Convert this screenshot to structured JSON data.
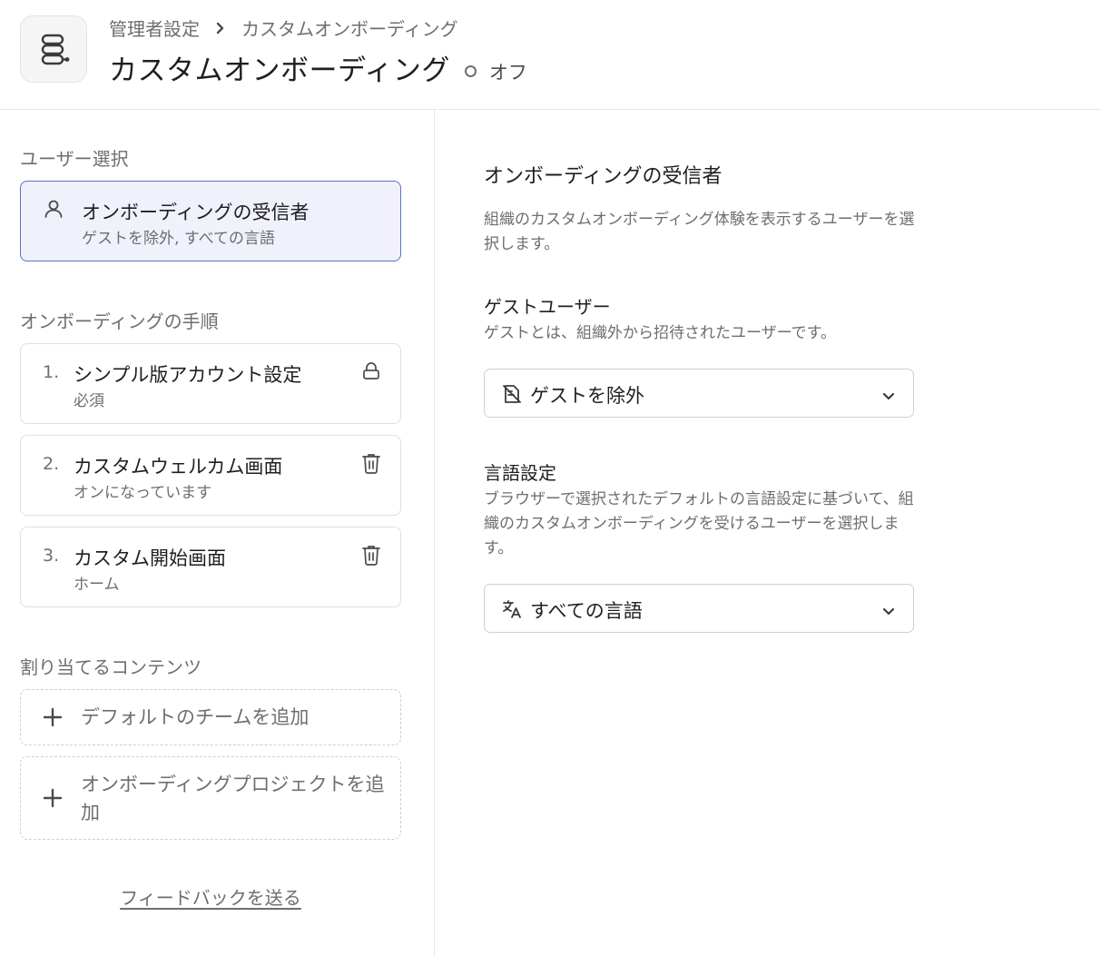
{
  "header": {
    "app_icon": "onboarding-icon",
    "breadcrumb": {
      "parent": "管理者設定",
      "current": "カスタムオンボーディング"
    },
    "title": "カスタムオンボーディング",
    "status": "オフ"
  },
  "left": {
    "user_select_label": "ユーザー選択",
    "recipient": {
      "icon": "user-icon",
      "title": "オンボーディングの受信者",
      "subtitle": "ゲストを除外, すべての言語"
    },
    "steps_label": "オンボーディングの手順",
    "steps": [
      {
        "num": "1.",
        "title": "シンプル版アカウント設定",
        "subtitle": "必須",
        "action_icon": "lock-icon"
      },
      {
        "num": "2.",
        "title": "カスタムウェルカム画面",
        "subtitle": "オンになっています",
        "action_icon": "trash-icon"
      },
      {
        "num": "3.",
        "title": "カスタム開始画面",
        "subtitle": "ホーム",
        "action_icon": "trash-icon"
      }
    ],
    "content_label": "割り当てるコンテンツ",
    "add_items": [
      {
        "label": "デフォルトのチームを追加",
        "icon": "plus-icon"
      },
      {
        "label": "オンボーディングプロジェクトを追加",
        "icon": "plus-icon"
      }
    ],
    "feedback": "フィードバックを送る"
  },
  "right": {
    "title": "オンボーディングの受信者",
    "description": "組織のカスタムオンボーディング体験を表示するユーザーを選択します。",
    "guest": {
      "title": "ゲストユーザー",
      "description": "ゲストとは、組織外から招待されたユーザーです。",
      "select_value": "ゲストを除外",
      "select_icon": "guest-excluded-icon"
    },
    "language": {
      "title": "言語設定",
      "description": "ブラウザーで選択されたデフォルトの言語設定に基づいて、組織のカスタムオンボーディングを受けるユーザーを選択します。",
      "select_value": "すべての言語",
      "select_icon": "translate-icon"
    }
  },
  "colors": {
    "selected_bg": "#f0f1fb",
    "selected_border": "#5a6fc9",
    "muted_text": "#6d6e6f",
    "border": "#e0e0e0"
  }
}
